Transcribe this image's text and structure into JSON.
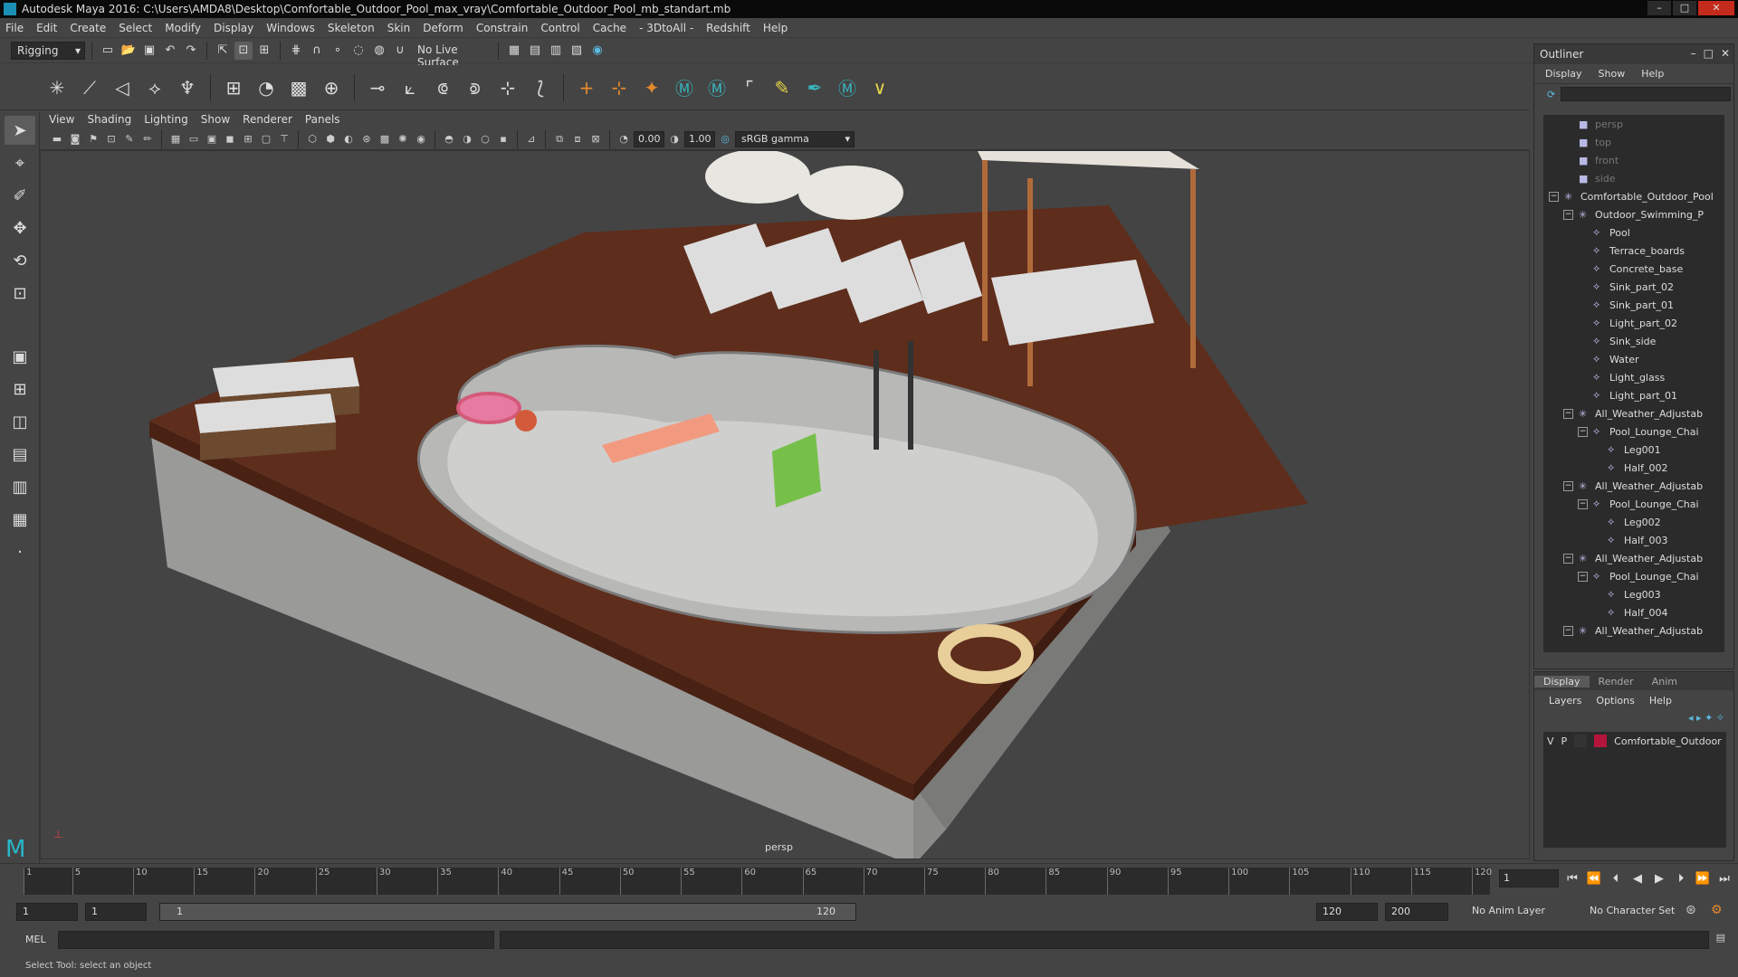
{
  "window": {
    "title": "Autodesk Maya 2016: C:\\Users\\AMDA8\\Desktop\\Comfortable_Outdoor_Pool_max_vray\\Comfortable_Outdoor_Pool_mb_standart.mb"
  },
  "menubar": [
    "File",
    "Edit",
    "Create",
    "Select",
    "Modify",
    "Display",
    "Windows",
    "Skeleton",
    "Skin",
    "Deform",
    "Constrain",
    "Control",
    "Cache",
    "- 3DtoAll -",
    "Redshift",
    "Help"
  ],
  "statusline": {
    "menuset": "Rigging",
    "live_surface": "No Live Surface"
  },
  "panel": {
    "menus": [
      "View",
      "Shading",
      "Lighting",
      "Show",
      "Renderer",
      "Panels"
    ],
    "near_value": "0.00",
    "far_value": "1.00",
    "color_space": "sRGB gamma",
    "camera_label": "persp"
  },
  "outliner": {
    "title": "Outliner",
    "menus": [
      "Display",
      "Show",
      "Help"
    ],
    "items": [
      {
        "label": "persp",
        "depth": 1,
        "icon": "camera-icon",
        "dim": true
      },
      {
        "label": "top",
        "depth": 1,
        "icon": "camera-icon",
        "dim": true
      },
      {
        "label": "front",
        "depth": 1,
        "icon": "camera-icon",
        "dim": true
      },
      {
        "label": "side",
        "depth": 1,
        "icon": "camera-icon",
        "dim": true
      },
      {
        "label": "Comfortable_Outdoor_Pool",
        "depth": 0,
        "icon": "group-icon",
        "exp": "−"
      },
      {
        "label": "Outdoor_Swimming_P",
        "depth": 1,
        "icon": "group-icon",
        "exp": "−"
      },
      {
        "label": "Pool",
        "depth": 2,
        "icon": "mesh-icon"
      },
      {
        "label": "Terrace_boards",
        "depth": 2,
        "icon": "mesh-icon"
      },
      {
        "label": "Concrete_base",
        "depth": 2,
        "icon": "mesh-icon"
      },
      {
        "label": "Sink_part_02",
        "depth": 2,
        "icon": "mesh-icon"
      },
      {
        "label": "Sink_part_01",
        "depth": 2,
        "icon": "mesh-icon"
      },
      {
        "label": "Light_part_02",
        "depth": 2,
        "icon": "mesh-icon"
      },
      {
        "label": "Sink_side",
        "depth": 2,
        "icon": "mesh-icon"
      },
      {
        "label": "Water",
        "depth": 2,
        "icon": "mesh-icon"
      },
      {
        "label": "Light_glass",
        "depth": 2,
        "icon": "mesh-icon"
      },
      {
        "label": "Light_part_01",
        "depth": 2,
        "icon": "mesh-icon"
      },
      {
        "label": "All_Weather_Adjustab",
        "depth": 1,
        "icon": "group-icon",
        "exp": "−"
      },
      {
        "label": "Pool_Lounge_Chai",
        "depth": 2,
        "icon": "mesh-icon",
        "exp": "−"
      },
      {
        "label": "Leg001",
        "depth": 3,
        "icon": "mesh-icon"
      },
      {
        "label": "Half_002",
        "depth": 3,
        "icon": "mesh-icon"
      },
      {
        "label": "All_Weather_Adjustab",
        "depth": 1,
        "icon": "group-icon",
        "exp": "−"
      },
      {
        "label": "Pool_Lounge_Chai",
        "depth": 2,
        "icon": "mesh-icon",
        "exp": "−"
      },
      {
        "label": "Leg002",
        "depth": 3,
        "icon": "mesh-icon"
      },
      {
        "label": "Half_003",
        "depth": 3,
        "icon": "mesh-icon"
      },
      {
        "label": "All_Weather_Adjustab",
        "depth": 1,
        "icon": "group-icon",
        "exp": "−"
      },
      {
        "label": "Pool_Lounge_Chai",
        "depth": 2,
        "icon": "mesh-icon",
        "exp": "−"
      },
      {
        "label": "Leg003",
        "depth": 3,
        "icon": "mesh-icon"
      },
      {
        "label": "Half_004",
        "depth": 3,
        "icon": "mesh-icon"
      },
      {
        "label": "All_Weather_Adjustab",
        "depth": 1,
        "icon": "group-icon",
        "exp": "−"
      }
    ]
  },
  "layers": {
    "tabs": [
      "Display",
      "Render",
      "Anim"
    ],
    "menus": [
      "Layers",
      "Options",
      "Help"
    ],
    "row": {
      "v": "V",
      "p": "P",
      "name": "Comfortable_Outdoor",
      "color": "#b5143c"
    }
  },
  "timeline": {
    "ticks": [
      "1",
      "5",
      "10",
      "15",
      "20",
      "25",
      "30",
      "35",
      "40",
      "45",
      "50",
      "55",
      "60",
      "65",
      "70",
      "75",
      "80",
      "85",
      "90",
      "95",
      "100",
      "105",
      "110",
      "115",
      "120"
    ],
    "current_frame": "1"
  },
  "range": {
    "start": "1",
    "anim_start": "1",
    "slider_start": "1",
    "slider_end": "120",
    "end": "120",
    "anim_end": "200",
    "anim_layer": "No Anim Layer",
    "char_set": "No Character Set"
  },
  "cmdline": {
    "label": "MEL"
  },
  "helpline": {
    "text": "Select Tool: select an object"
  }
}
